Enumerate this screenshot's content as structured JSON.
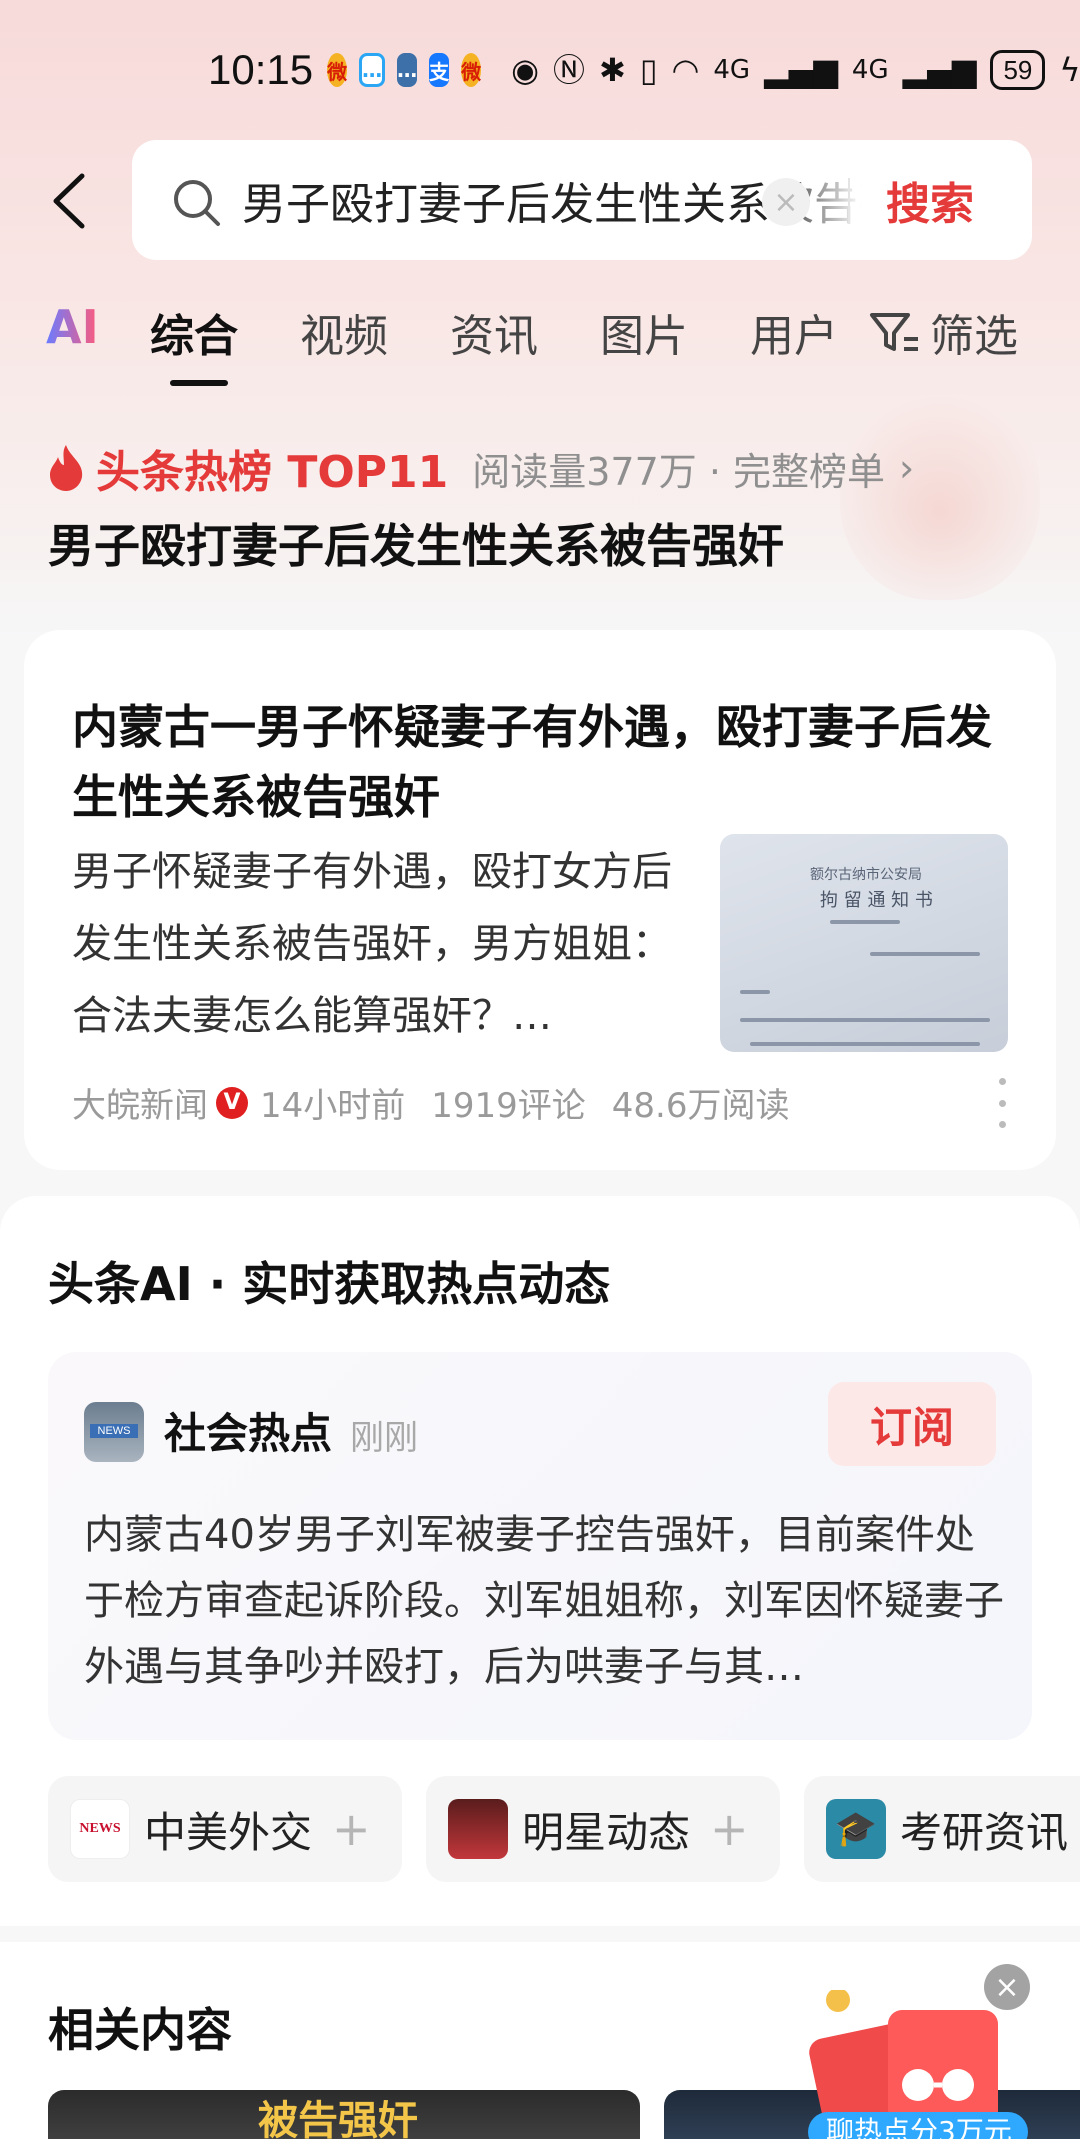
{
  "status_bar": {
    "time": "10:15",
    "network": "4G",
    "network2": "4G",
    "battery": "59"
  },
  "search": {
    "value": "男子殴打妻子后发生性关系被告强奸",
    "button": "搜索",
    "clear": "×"
  },
  "tabs": {
    "ai": "AI",
    "items": [
      "综合",
      "视频",
      "资讯",
      "图片",
      "用户"
    ],
    "active_index": 0,
    "filter": "筛选"
  },
  "hot": {
    "label": "头条热榜 TOP11",
    "read": "阅读量377万 · 完整榜单",
    "chevron": "›",
    "title": "男子殴打妻子后发生性关系被告强奸"
  },
  "article": {
    "title": "内蒙古一男子怀疑妻子有外遇，殴打妻子后发生性关系被告强奸",
    "summary": "男子怀疑妻子有外遇，殴打女方后发生性关系被告强奸，男方姐姐：合法夫妻怎么能算强奸？…",
    "source": "大皖新闻",
    "verified_badge": "V",
    "time": "14小时前",
    "comments": "1919评论",
    "reads": "48.6万阅读",
    "thumb_text_1": "额尔古纳市公安局",
    "thumb_text_2": "拘 留 通 知 书"
  },
  "ai_section": {
    "heading": "头条AI · 实时获取热点动态",
    "card": {
      "source": "社会热点",
      "time": "刚刚",
      "subscribe": "订阅",
      "text": "内蒙古40岁男子刘军被妻子控告强奸，目前案件处于检方审查起诉阶段。刘军姐姐称，刘军因怀疑妻子外遇与其争吵并殴打，后为哄妻子与其…"
    },
    "topics": [
      {
        "label": "中美外交",
        "plus": "+"
      },
      {
        "label": "明星动态",
        "plus": "+"
      },
      {
        "label": "考研资讯",
        "plus": "+"
      }
    ]
  },
  "related": {
    "heading": "相关内容",
    "thumb1_text": "被告强奸",
    "banner": "聊热点分3万元"
  },
  "colors": {
    "accent_red": "#e53a3a",
    "background": "#f7f7f8"
  }
}
